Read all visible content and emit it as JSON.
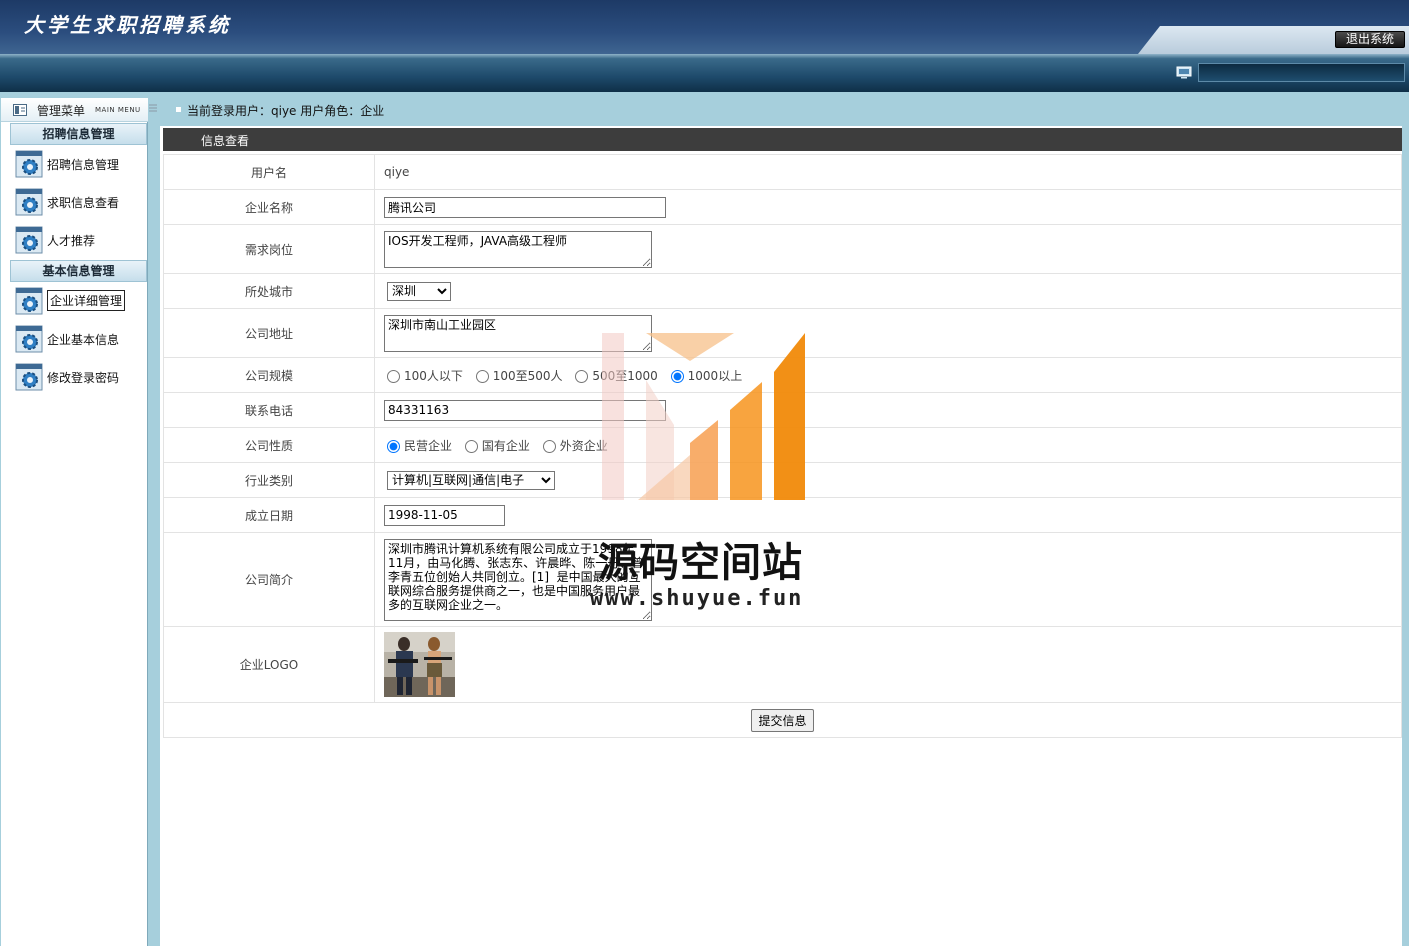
{
  "header": {
    "app_title": "大学生求职招聘系统",
    "logout_label": "退出系统"
  },
  "sidebar": {
    "menu_title": "管理菜单",
    "menu_subtitle": "MAIN MENU",
    "sections": [
      {
        "title": "招聘信息管理",
        "items": [
          {
            "label": "招聘信息管理",
            "icon": "gear-icon"
          },
          {
            "label": "求职信息查看",
            "icon": "gear-icon"
          },
          {
            "label": "人才推荐",
            "icon": "gear-icon"
          }
        ]
      },
      {
        "title": "基本信息管理",
        "items": [
          {
            "label": "企业详细管理",
            "icon": "gear-icon",
            "active": true
          },
          {
            "label": "企业基本信息",
            "icon": "gear-icon"
          },
          {
            "label": "修改登录密码",
            "icon": "gear-icon"
          }
        ]
      }
    ]
  },
  "breadcrumb": {
    "current_user_text": "当前登录用户：qiye  用户角色：企业"
  },
  "panel": {
    "title": "信息查看"
  },
  "form": {
    "username": {
      "label": "用户名",
      "value": "qiye"
    },
    "company_name": {
      "label": "企业名称",
      "value": "腾讯公司"
    },
    "positions": {
      "label": "需求岗位",
      "value": "IOS开发工程师，JAVA高级工程师"
    },
    "city": {
      "label": "所处城市",
      "value": "深圳"
    },
    "address": {
      "label": "公司地址",
      "value": "深圳市南山工业园区"
    },
    "scale": {
      "label": "公司规模",
      "options": [
        "100人以下",
        "100至500人",
        "500至1000",
        "1000以上"
      ],
      "selected": "1000以上"
    },
    "phone": {
      "label": "联系电话",
      "value": "84331163"
    },
    "nature": {
      "label": "公司性质",
      "options": [
        "民营企业",
        "国有企业",
        "外资企业"
      ],
      "selected": "民营企业"
    },
    "industry": {
      "label": "行业类别",
      "value": "计算机|互联网|通信|电子"
    },
    "founded": {
      "label": "成立日期",
      "value": "1998-11-05"
    },
    "intro": {
      "label": "公司简介",
      "value": "深圳市腾讯计算机系统有限公司成立于1998年11月，由马化腾、张志东、许晨晔、陈一丹、曾李青五位创始人共同创立。[1]  是中国最大的互联网综合服务提供商之一，也是中国服务用户最多的互联网企业之一。"
    },
    "logo": {
      "label": "企业LOGO"
    },
    "submit_label": "提交信息"
  },
  "watermark": {
    "title": "源码空间站",
    "url": "www.shuyue.fun"
  },
  "colors": {
    "header_dark": "#1d3a66",
    "frame_blue": "#a6cfdc",
    "panel_title_bg": "#3d3d3d",
    "watermark_orange": "#f7941d"
  }
}
